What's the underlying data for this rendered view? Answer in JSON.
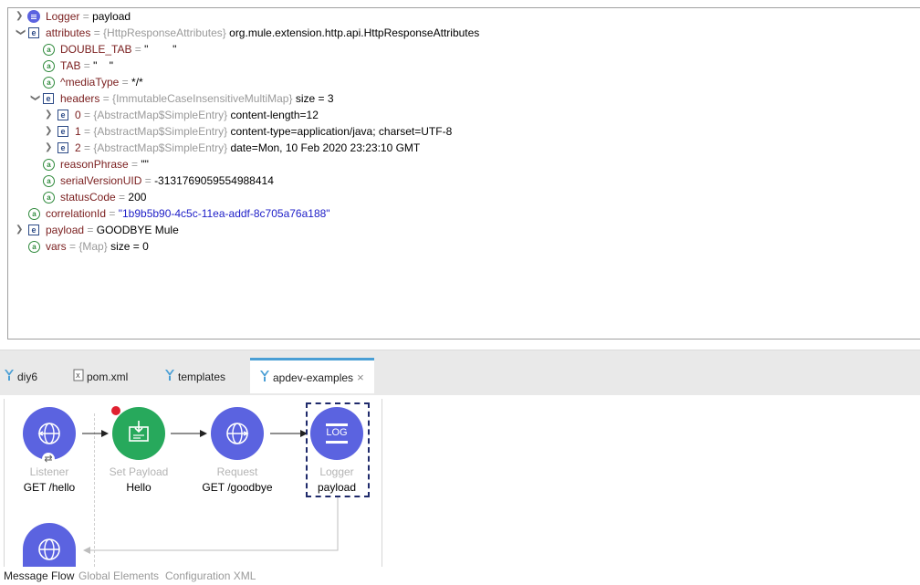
{
  "tree": {
    "logger": {
      "key": "Logger",
      "eq": " = ",
      "value": "payload"
    },
    "attributes": {
      "key": "attributes",
      "type": "= {HttpResponseAttributes}",
      "value": "org.mule.extension.http.api.HttpResponseAttributes"
    },
    "double_tab": {
      "key": "DOUBLE_TAB",
      "eq": " = ",
      "value": "\"        \""
    },
    "tab": {
      "key": "TAB",
      "eq": " = ",
      "value": "\"    \""
    },
    "media_type": {
      "key": "^mediaType",
      "eq": " = ",
      "value": "*/*"
    },
    "headers": {
      "key": "headers",
      "type": "= {ImmutableCaseInsensitiveMultiMap}",
      "value": "size = 3"
    },
    "header_0": {
      "key": "0",
      "type": "= {AbstractMap$SimpleEntry}",
      "value": "content-length=12"
    },
    "header_1": {
      "key": "1",
      "type": "= {AbstractMap$SimpleEntry}",
      "value": "content-type=application/java; charset=UTF-8"
    },
    "header_2": {
      "key": "2",
      "type": "= {AbstractMap$SimpleEntry}",
      "value": "date=Mon, 10 Feb 2020 23:23:10 GMT"
    },
    "reason_phrase": {
      "key": "reasonPhrase",
      "eq": " = ",
      "value": "\"\""
    },
    "serial_version_uid": {
      "key": "serialVersionUID",
      "eq": " = ",
      "value": "-3131769059554988414"
    },
    "status_code": {
      "key": "statusCode",
      "eq": " = ",
      "value": "200"
    },
    "correlation_id": {
      "key": "correlationId",
      "eq": " = ",
      "value": "\"1b9b5b90-4c5c-11ea-addf-8c705a76a188\""
    },
    "payload": {
      "key": "payload",
      "eq": " = ",
      "value": "GOODBYE Mule"
    },
    "vars": {
      "key": "vars",
      "type": "= {Map}",
      "value": "size = 0"
    }
  },
  "tabs": [
    {
      "label": "diy6"
    },
    {
      "label": "pom.xml"
    },
    {
      "label": "templates"
    },
    {
      "label": "apdev-examples",
      "close": "×"
    }
  ],
  "flow": {
    "listener": {
      "title": "Listener",
      "sub": "GET /hello"
    },
    "set_payload": {
      "title": "Set Payload",
      "sub": "Hello"
    },
    "request": {
      "title": "Request",
      "sub": "GET /goodbye"
    },
    "logger": {
      "title": "Logger",
      "sub": "payload",
      "badge": "LOG"
    }
  },
  "bottom_tabs": [
    "Message Flow",
    "Global Elements",
    "Configuration XML"
  ],
  "colors": {
    "node_purple": "#5b63e0",
    "node_green": "#27a95c",
    "active_tab_accent": "#4a9fd5",
    "breakpoint": "#e02030"
  }
}
